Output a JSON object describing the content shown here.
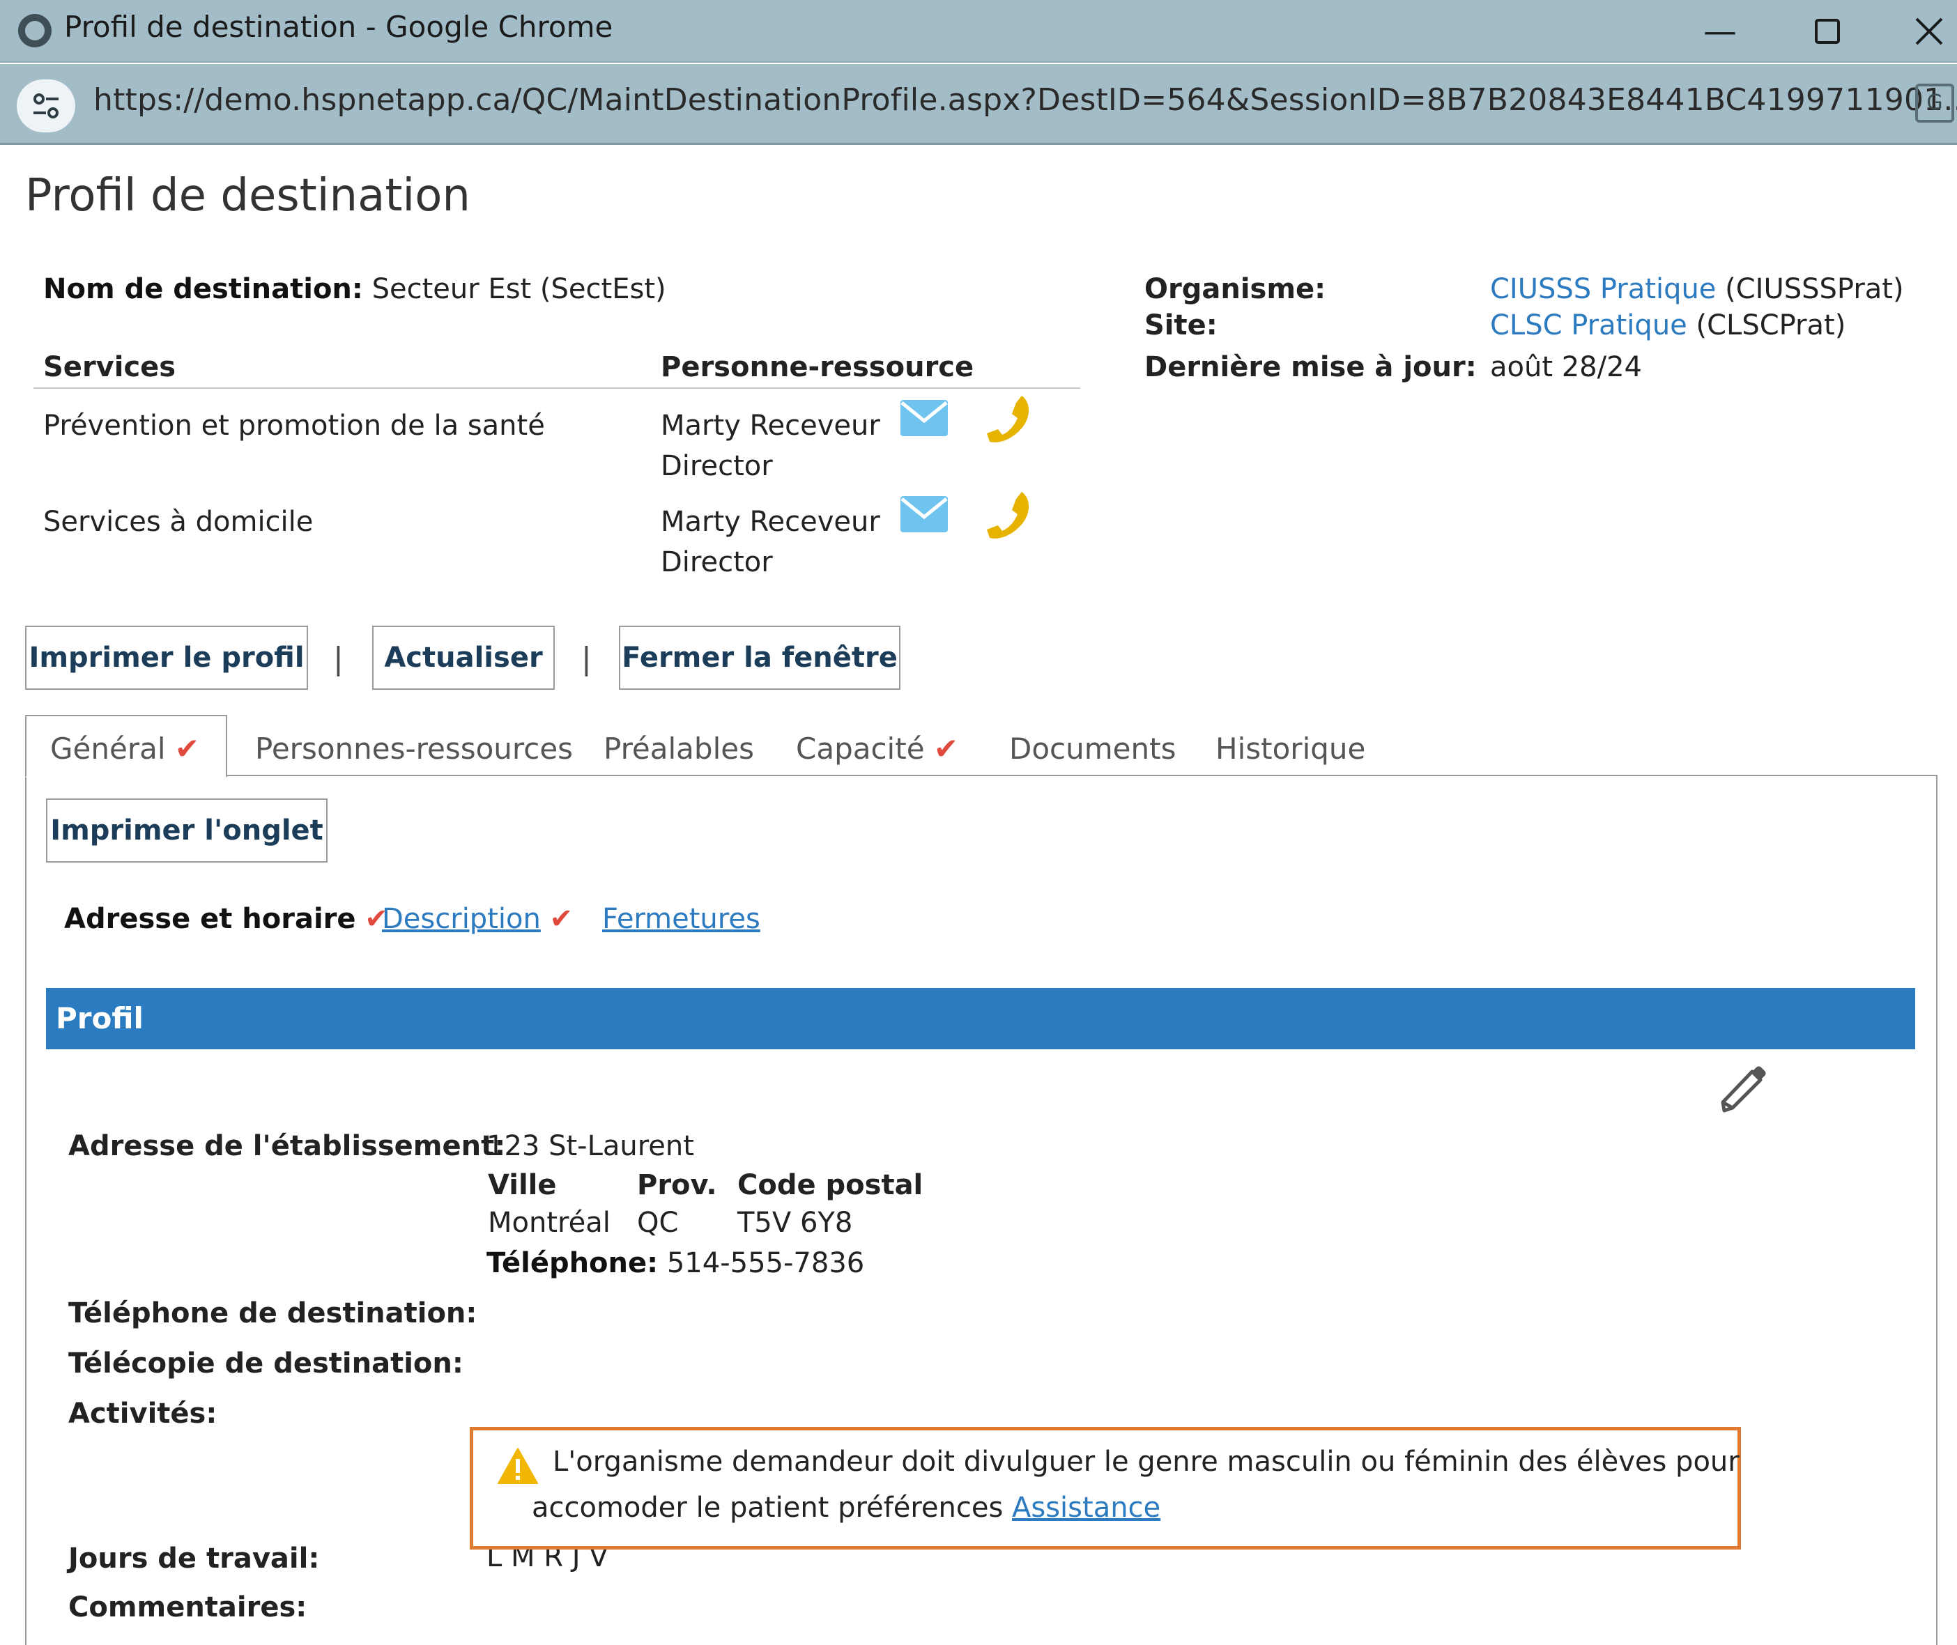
{
  "browser": {
    "window_title": "Profil de destination - Google Chrome",
    "url": "https://demo.hspnetapp.ca/QC/MaintDestinationProfile.aspx?DestID=564&SessionID=8B7B20843E8441BC4199711901...",
    "minimize_symbol": "—",
    "maximize_symbol": "☐",
    "close_symbol": "✕"
  },
  "page": {
    "title": "Profil de destination"
  },
  "header": {
    "dest_name_label": "Nom de destination:",
    "dest_name_value": "Secteur Est (SectEst)",
    "organism_label": "Organisme:",
    "organism_link": "CIUSSS Pratique",
    "organism_code": "(CIUSSSPrat)",
    "site_label": "Site:",
    "site_link": "CLSC Pratique",
    "site_code": "(CLSCPrat)",
    "updated_label": "Dernière mise à jour:",
    "updated_value": "août 28/24"
  },
  "services_table": {
    "col_services": "Services",
    "col_contact": "Personne-ressource",
    "rows": [
      {
        "service": "Prévention et promotion de la santé",
        "name": "Marty Receveur",
        "role": "Director"
      },
      {
        "service": "Services à domicile",
        "name": "Marty Receveur",
        "role": "Director"
      }
    ]
  },
  "actions": {
    "print_profile": "Imprimer le profil",
    "refresh": "Actualiser",
    "close_window": "Fermer la fenêtre",
    "separator": "|"
  },
  "tabs": [
    {
      "label": "Général",
      "check": "✔"
    },
    {
      "label": "Personnes-ressources"
    },
    {
      "label": "Préalables"
    },
    {
      "label": "Capacité",
      "check": "✔"
    },
    {
      "label": "Documents"
    },
    {
      "label": "Historique"
    }
  ],
  "panel": {
    "print_tab": "Imprimer l'onglet",
    "subtabs": [
      {
        "label": "Adresse et horaire",
        "check": "✔"
      },
      {
        "label": "Description",
        "check": "✔"
      },
      {
        "label": "Fermetures"
      }
    ],
    "section_title": "Profil"
  },
  "profile": {
    "address_label": "Adresse de l'établissement:",
    "address_value": "123 St-Laurent",
    "city_label": "Ville",
    "prov_label": "Prov.",
    "postal_label": "Code postal",
    "city_value": "Montréal",
    "prov_value": "QC",
    "postal_value": "T5V 6Y8",
    "phone_label": "Téléphone:",
    "phone_value": "514-555-7836",
    "dest_phone_label": "Téléphone de destination:",
    "dest_fax_label": "Télécopie de destination:",
    "activities_label": "Activités:",
    "work_days_label": "Jours de travail:",
    "work_days_value": "L M R J V",
    "comments_label": "Commentaires:"
  },
  "warning": {
    "text_line1": "L'organisme demandeur doit divulguer le genre masculin ou féminin des élèves pour",
    "text_line2": "accomoder le patient préférences",
    "link": "Assistance",
    "border_color": "#e37a32"
  },
  "colors": {
    "chrome_bg": "#a3bdc8",
    "link": "#2c7bc0",
    "section_bar": "#2a7bbf",
    "check": "#e04a3c",
    "email_icon": "#6ec3ef",
    "phone_icon": "#e6b400"
  }
}
